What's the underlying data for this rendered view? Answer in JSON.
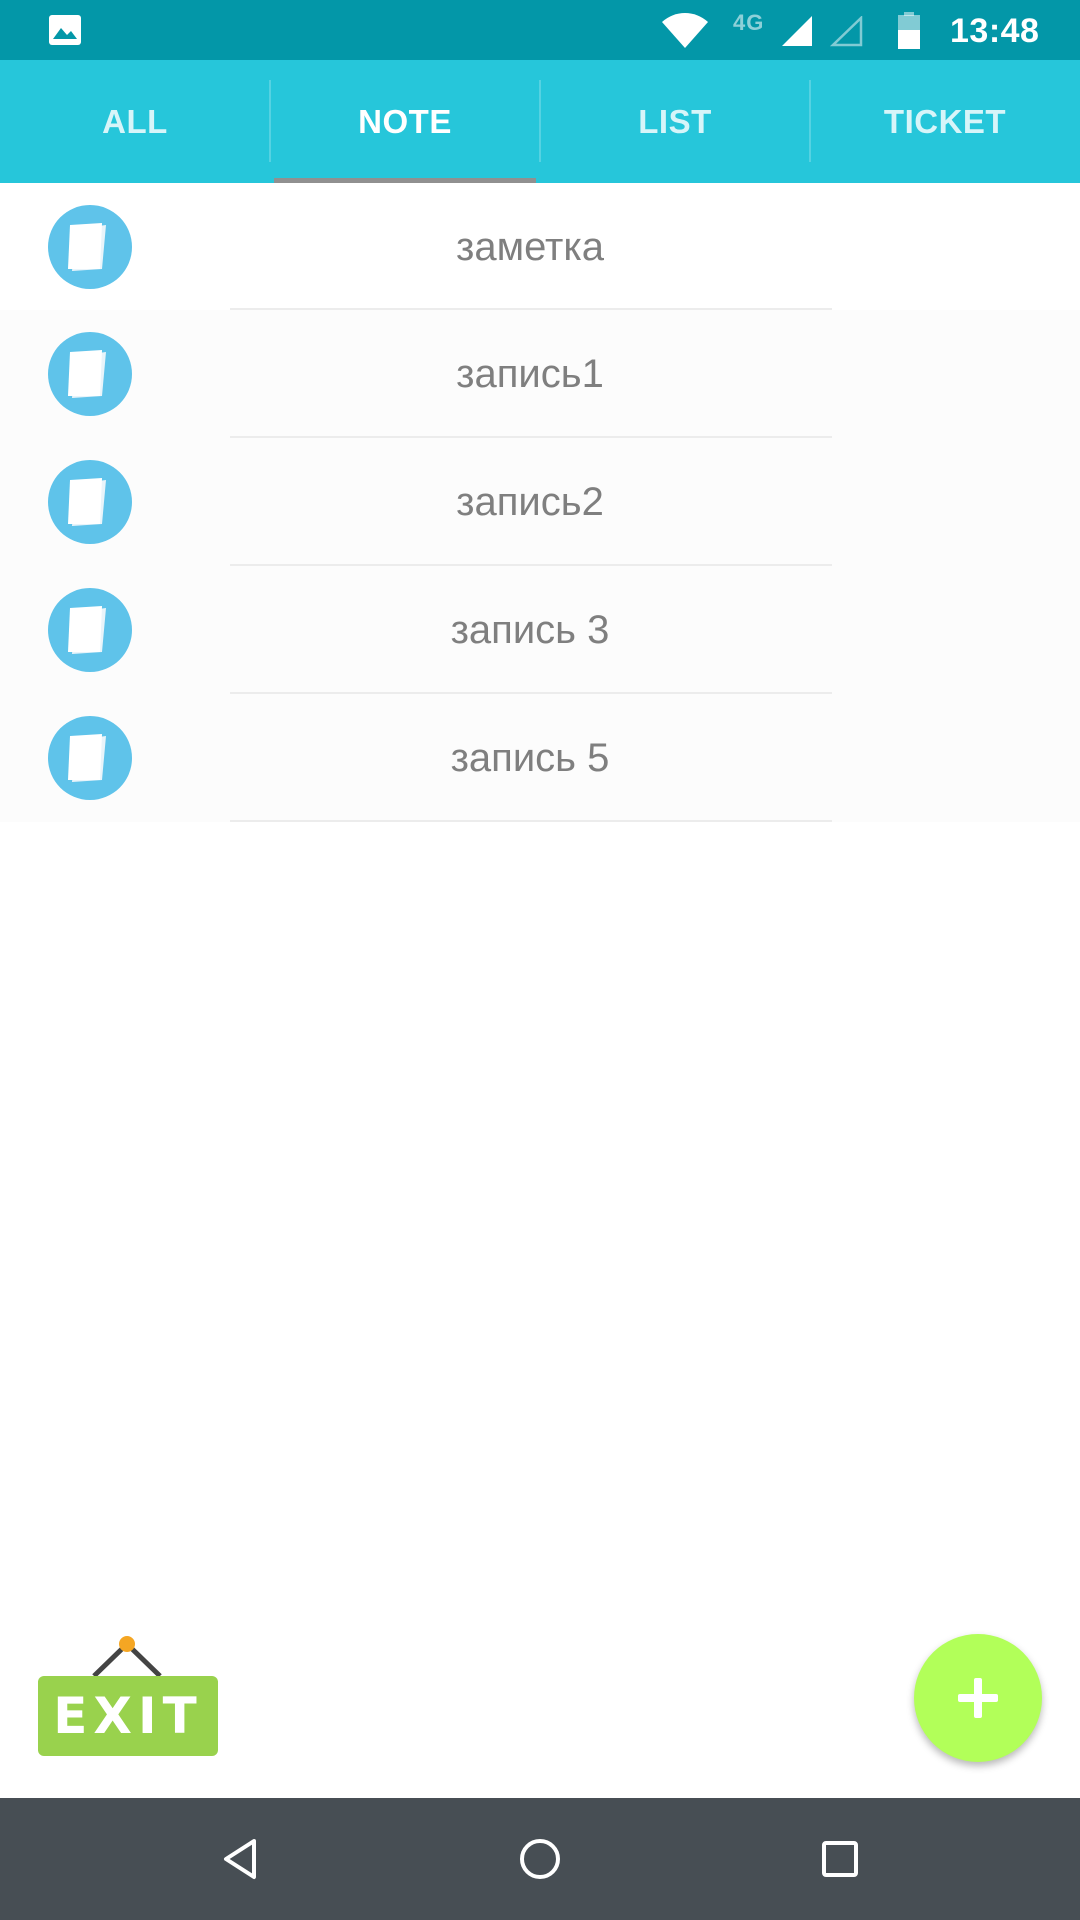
{
  "status_bar": {
    "time": "13:48",
    "network_type": "4G",
    "icons": [
      "gallery-icon",
      "wifi-icon",
      "signal-icon",
      "signal-empty-icon",
      "battery-icon"
    ]
  },
  "tabs": [
    {
      "label": "ALL",
      "active": false
    },
    {
      "label": "NOTE",
      "active": true
    },
    {
      "label": "LIST",
      "active": false
    },
    {
      "label": "TICKET",
      "active": false
    }
  ],
  "notes": [
    {
      "title": "заметка",
      "icon": "note-icon"
    },
    {
      "title": "запись1",
      "icon": "note-icon"
    },
    {
      "title": "запись2",
      "icon": "note-icon"
    },
    {
      "title": "запись 3",
      "icon": "note-icon"
    },
    {
      "title": "запись 5",
      "icon": "note-icon"
    }
  ],
  "exit_button": {
    "label": "EXIT"
  },
  "fab": {
    "icon": "plus-icon"
  },
  "nav_bar": {
    "icons": [
      "back-icon",
      "home-icon",
      "recents-icon"
    ]
  },
  "colors": {
    "status_bar": "#0397a8",
    "tab_bar": "#26c6da",
    "tab_indicator": "#909090",
    "note_icon": "#5fc3ea",
    "note_text": "#7f7f7f",
    "exit_sign": "#99d24d",
    "fab": "#b2ff59",
    "nav_bar": "#474e54"
  }
}
